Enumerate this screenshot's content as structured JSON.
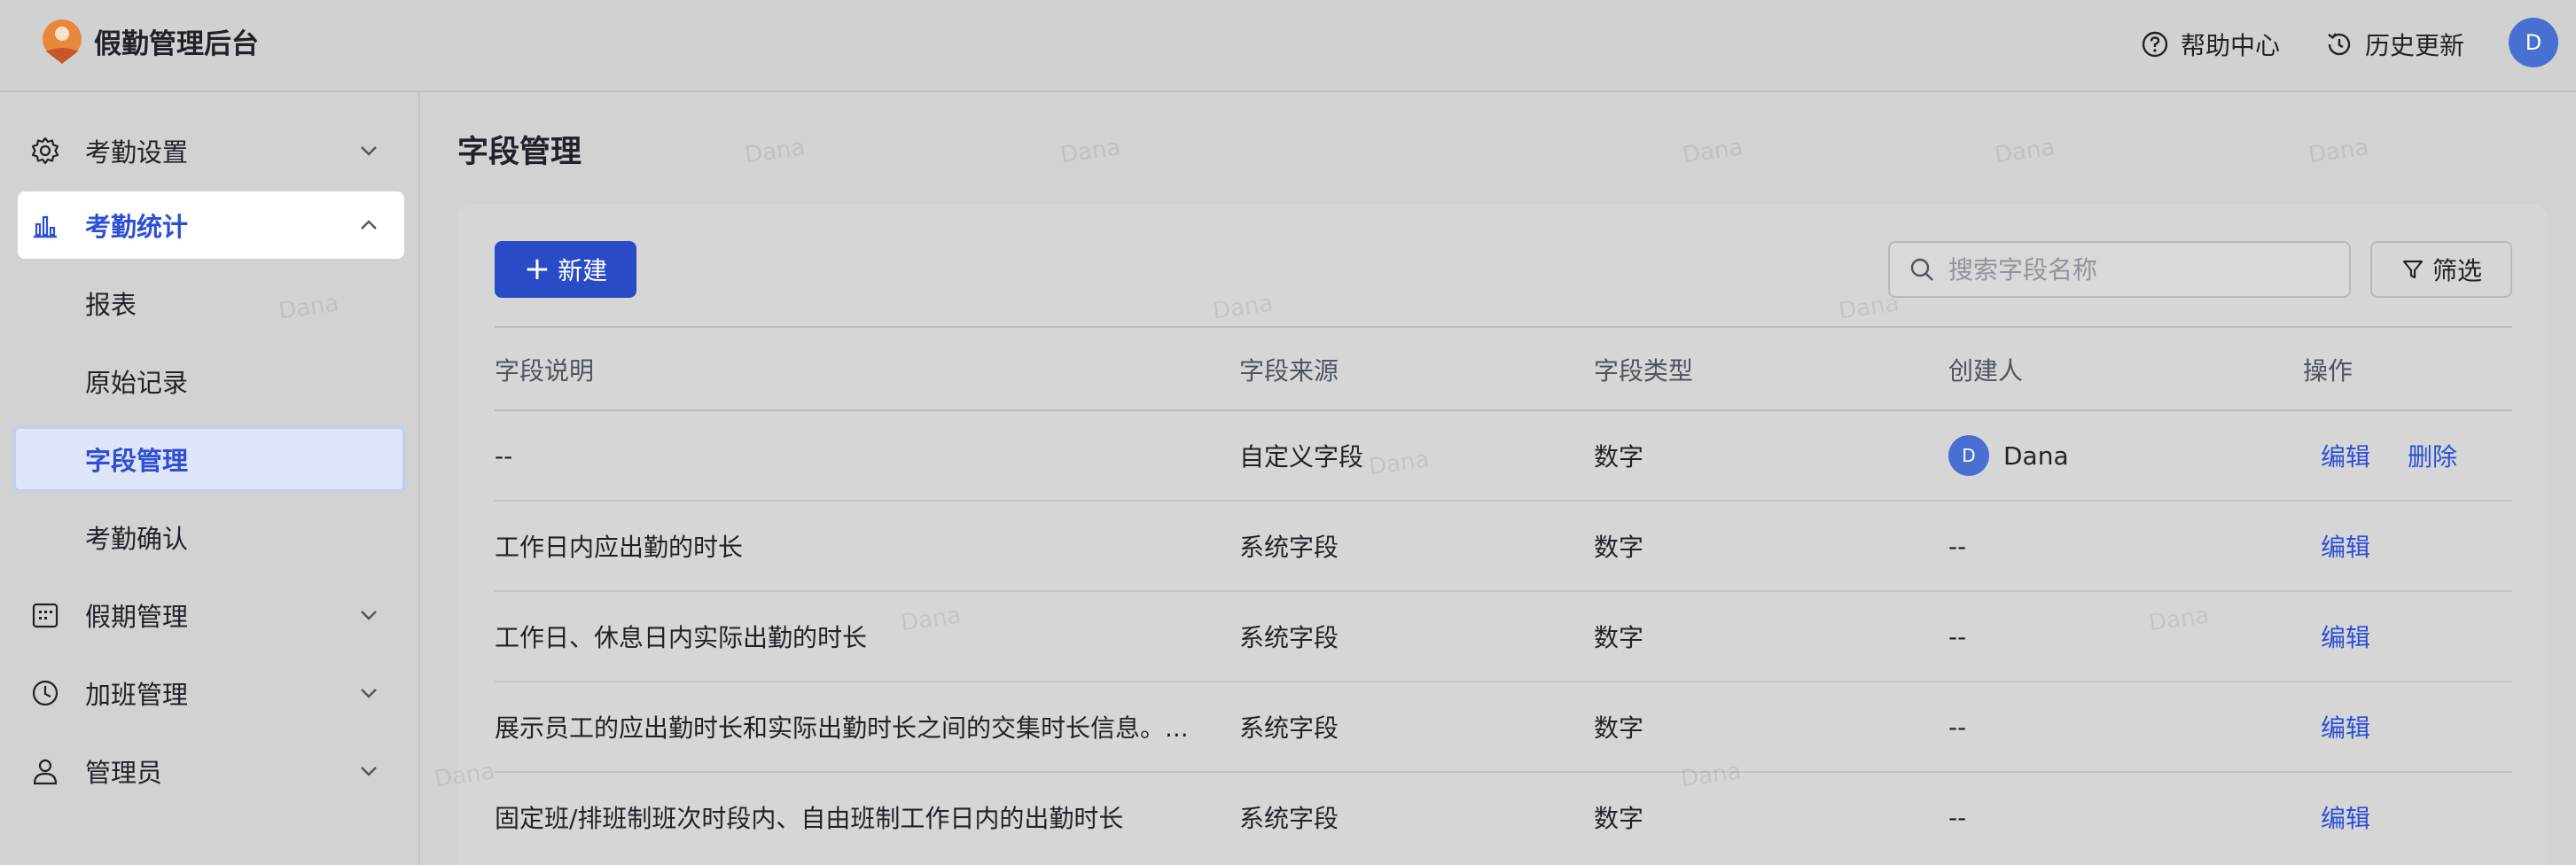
{
  "header": {
    "app_title": "假勤管理后台",
    "help_label": "帮助中心",
    "history_label": "历史更新",
    "avatar_letter": "D"
  },
  "sidebar": {
    "items": [
      {
        "label": "考勤设置",
        "icon": "gear-icon",
        "expanded": false
      },
      {
        "label": "考勤统计",
        "icon": "bar-chart-icon",
        "expanded": true,
        "children": [
          {
            "label": "报表"
          },
          {
            "label": "原始记录"
          },
          {
            "label": "字段管理",
            "selected": true
          },
          {
            "label": "考勤确认"
          }
        ]
      },
      {
        "label": "假期管理",
        "icon": "calendar-icon",
        "expanded": false
      },
      {
        "label": "加班管理",
        "icon": "clock-icon",
        "expanded": false
      },
      {
        "label": "管理员",
        "icon": "user-icon",
        "expanded": false
      }
    ]
  },
  "main": {
    "page_title": "字段管理",
    "new_button": "新建",
    "search_placeholder": "搜索字段名称",
    "filter_button": "筛选",
    "columns": [
      "字段说明",
      "字段来源",
      "字段类型",
      "创建人",
      "操作"
    ],
    "rows": [
      {
        "desc": "--",
        "source": "自定义字段",
        "type": "数字",
        "creator": "Dana",
        "creator_avatar": "D",
        "edit": "编辑",
        "delete": "删除"
      },
      {
        "desc": "工作日内应出勤的时长",
        "source": "系统字段",
        "type": "数字",
        "creator": "--",
        "edit": "编辑"
      },
      {
        "desc": "工作日、休息日内实际出勤的时长",
        "source": "系统字段",
        "type": "数字",
        "creator": "--",
        "edit": "编辑"
      },
      {
        "desc": "展示员工的应出勤时长和实际出勤时长之间的交集时长信息。...",
        "source": "系统字段",
        "type": "数字",
        "creator": "--",
        "edit": "编辑"
      },
      {
        "desc": "固定班/排班制班次时段内、自由班制工作日内的出勤时长",
        "source": "系统字段",
        "type": "数字",
        "creator": "--",
        "edit": "编辑"
      }
    ]
  },
  "watermark": "Dana",
  "colors": {
    "accent": "#2c4fd6",
    "primary_button": "#2a4bc7",
    "avatar": "#4a6fd3"
  }
}
